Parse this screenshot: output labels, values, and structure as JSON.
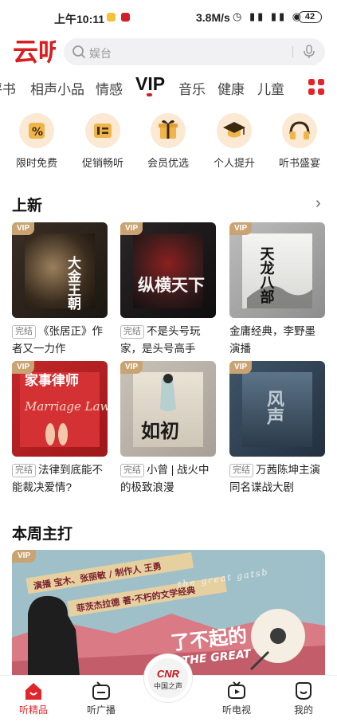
{
  "status_bar": {
    "time": "上午10:11",
    "network_speed": "3.8M/s",
    "battery": "42"
  },
  "header": {
    "logo_text": "云听",
    "search_placeholder": "娱台"
  },
  "tabs": [
    {
      "label": "评书"
    },
    {
      "label": "相声小品"
    },
    {
      "label": "情感"
    },
    {
      "label": "VIP"
    },
    {
      "label": "音乐"
    },
    {
      "label": "健康"
    },
    {
      "label": "儿童"
    }
  ],
  "active_tab": "VIP",
  "categories": [
    {
      "label": "限时免费",
      "icon": "percent-icon"
    },
    {
      "label": "促销畅听",
      "icon": "promo-icon"
    },
    {
      "label": "会员优选",
      "icon": "gift-icon"
    },
    {
      "label": "个人提升",
      "icon": "graduation-cap-icon"
    },
    {
      "label": "听书盛宴",
      "icon": "headphones-icon"
    }
  ],
  "new_section": {
    "title": "上新"
  },
  "cards": [
    {
      "vip": "VIP",
      "badge": "完结",
      "text": "《张居正》作者又一力作",
      "cover_title": "大金王朝"
    },
    {
      "vip": "VIP",
      "badge": "完结",
      "text": "不是头号玩家，是头号高手",
      "cover_title": "纵横天下"
    },
    {
      "vip": "VIP",
      "badge": "",
      "text": "金庸经典，李野墨演播",
      "cover_title": "天龙八部"
    },
    {
      "vip": "VIP",
      "badge": "完结",
      "text": "法律到底能不能裁决爱情?",
      "cover_title": "家事律师",
      "cover_sub": "Marriage Lawyer"
    },
    {
      "vip": "VIP",
      "badge": "完结",
      "text": "小曾 | 战火中的极致浪漫",
      "cover_title": "如初"
    },
    {
      "vip": "VIP",
      "badge": "完结",
      "text": "万茜陈坤主演同名谍战大剧",
      "cover_title": "风声"
    }
  ],
  "weekly_section": {
    "title": "本周主打",
    "banner": {
      "vip": "VIP",
      "line1": "演播 宝木、张丽敏 / 制作人 王勇",
      "line2": "菲茨杰拉德 著·不朽的文学经典",
      "english": "the great gatsb",
      "title_cn": "了不起的",
      "title_en": "THE GREAT"
    }
  },
  "bottom_nav": [
    {
      "label": "听精品"
    },
    {
      "label": "听广播"
    },
    {
      "label": "中国之声"
    },
    {
      "label": "听电视"
    },
    {
      "label": "我的"
    }
  ],
  "center_logo": "CNR",
  "colors": {
    "brand_red": "#e0262b",
    "vip_gold": "#c9a472",
    "category_bg": "#fbe9d3"
  }
}
